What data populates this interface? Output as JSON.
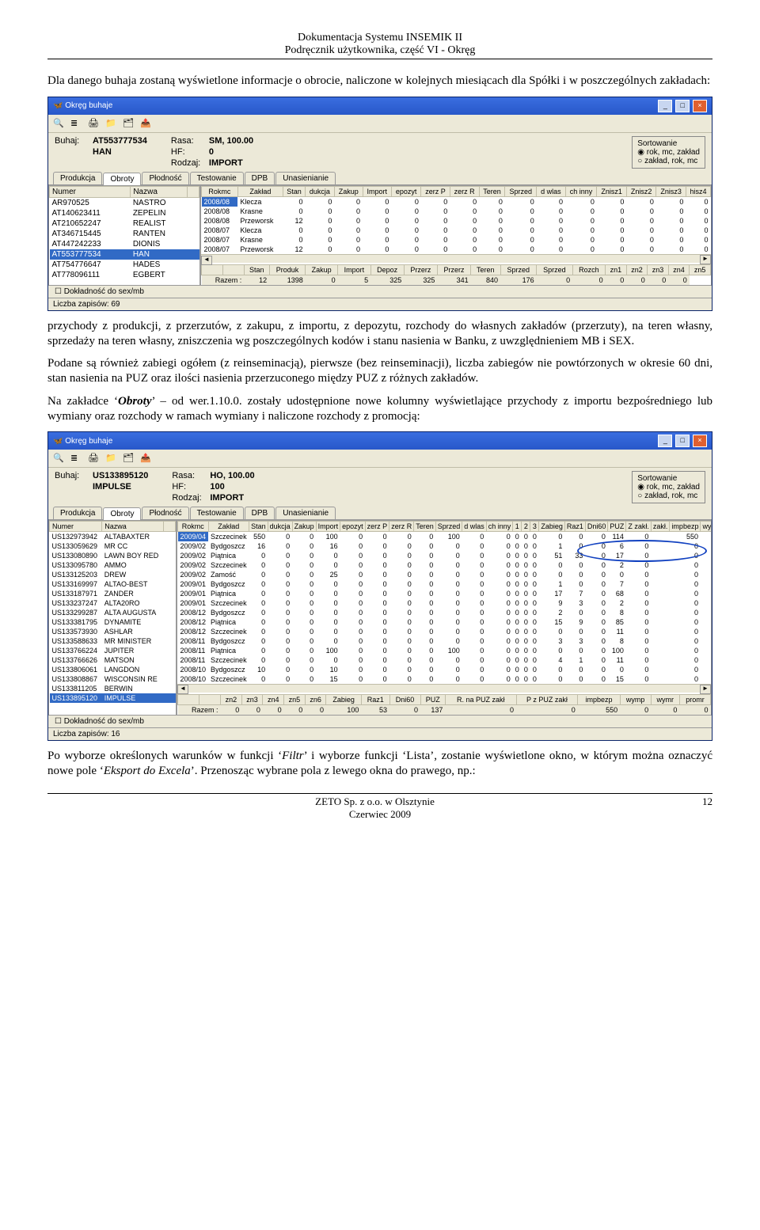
{
  "header": {
    "line1": "Dokumentacja Systemu INSEMIK II",
    "line2": "Podręcznik użytkownika, część VI - Okręg"
  },
  "para1": "Dla danego buhaja zostaną wyświetlone informacje o obrocie, naliczone w kolejnych miesiącach dla Spółki i w poszczególnych zakładach:",
  "win1": {
    "title": "Okręg buhaje",
    "buhaj": "AT553777534",
    "buhaj2": "HAN",
    "rasa": "SM, 100.00",
    "hf": "0",
    "rodzaj": "IMPORT",
    "sort1": "rok, mc, zakład",
    "sort2": "zakład, rok, mc",
    "sortLabel": "Sortowanie",
    "tabs": [
      "Produkcja",
      "Obroty",
      "Płodność",
      "Testowanie",
      "DPB",
      "Unasienianie"
    ],
    "leftHead": [
      "Numer",
      "Nazwa"
    ],
    "leftRows": [
      [
        "AR970525",
        "NASTRO"
      ],
      [
        "AT140623411",
        "ZEPELIN"
      ],
      [
        "AT210652247",
        "REALIST"
      ],
      [
        "AT346715445",
        "RANTEN"
      ],
      [
        "AT447242233",
        "DIONIS"
      ],
      [
        "AT553777534",
        "HAN"
      ],
      [
        "AT754776647",
        "HADES"
      ],
      [
        "AT778096111",
        "EGBERT"
      ]
    ],
    "gridHead": [
      "Rokmc",
      "Zakład",
      "Stan",
      "dukcja",
      "Zakup",
      "Import",
      "epozyt",
      "zerz P",
      "zerz R",
      "Teren",
      "Sprzed",
      "d wlas",
      "ch inny",
      "Znisz1",
      "Znisz2",
      "Znisz3",
      "hisz4"
    ],
    "gridRows": [
      [
        "2008/08",
        "Klecza",
        "0",
        "0",
        "0",
        "0",
        "0",
        "0",
        "0",
        "0",
        "0",
        "0",
        "0",
        "0",
        "0",
        "0",
        "0"
      ],
      [
        "2008/08",
        "Krasne",
        "0",
        "0",
        "0",
        "0",
        "0",
        "0",
        "0",
        "0",
        "0",
        "0",
        "0",
        "0",
        "0",
        "0",
        "0"
      ],
      [
        "2008/08",
        "Przeworsk",
        "12",
        "0",
        "0",
        "0",
        "0",
        "0",
        "0",
        "0",
        "0",
        "0",
        "0",
        "0",
        "0",
        "0",
        "0"
      ],
      [
        "2008/07",
        "Klecza",
        "0",
        "0",
        "0",
        "0",
        "0",
        "0",
        "0",
        "0",
        "0",
        "0",
        "0",
        "0",
        "0",
        "0",
        "0"
      ],
      [
        "2008/07",
        "Krasne",
        "0",
        "0",
        "0",
        "0",
        "0",
        "0",
        "0",
        "0",
        "0",
        "0",
        "0",
        "0",
        "0",
        "0",
        "0"
      ],
      [
        "2008/07",
        "Przeworsk",
        "12",
        "0",
        "0",
        "0",
        "0",
        "0",
        "0",
        "0",
        "0",
        "0",
        "0",
        "0",
        "0",
        "0",
        "0"
      ]
    ],
    "sumHead": [
      "Stan",
      "Produk",
      "Zakup",
      "Import",
      "Depoz",
      "Przerz",
      "Przerz",
      "Teren",
      "Sprzed",
      "Sprzed",
      "Rozch",
      "zn1",
      "zn2",
      "zn3",
      "zn4",
      "zn5"
    ],
    "sumRow": [
      "Razem :",
      "12",
      "1398",
      "0",
      "5",
      "325",
      "325",
      "341",
      "840",
      "176",
      "0",
      "0",
      "0",
      "0",
      "0",
      "0"
    ],
    "chk": "Dokładność do sex/mb",
    "status": "Liczba zapisów: 69"
  },
  "para2": "przychody z produkcji, z przerzutów, z zakupu, z importu, z depozytu, rozchody do własnych zakładów (przerzuty), na teren własny, sprzedaży na teren własny, zniszczenia wg poszczególnych kodów i stanu nasienia w Banku, z uwzględnieniem MB i SEX.",
  "para3": "Podane są również zabiegi ogółem (z reinseminacją), pierwsze (bez reinseminacji), liczba zabiegów nie powtórzonych w okresie 60 dni, stan nasienia na PUZ oraz ilości nasienia przerzuconego między PUZ z różnych zakładów.",
  "para4a": "Na zakładce ‘",
  "para4b": "Obroty",
  "para4c": "’ – od wer.1.10.0. zostały udostępnione nowe kolumny wyświetlające przychody z importu bezpośredniego lub wymiany oraz rozchody w ramach wymiany i naliczone rozchody z promocją:",
  "win2": {
    "title": "Okręg buhaje",
    "buhaj": "US133895120",
    "buhaj2": "IMPULSE",
    "rasa": "HO, 100.00",
    "hf": "100",
    "rodzaj": "IMPORT",
    "sort1": "rok, mc, zakład",
    "sort2": "zakład, rok, mc",
    "sortLabel": "Sortowanie",
    "tabs": [
      "Produkcja",
      "Obroty",
      "Płodność",
      "Testowanie",
      "DPB",
      "Unasienianie"
    ],
    "leftHead": [
      "Numer",
      "Nazwa"
    ],
    "leftRows": [
      [
        "US132973942",
        "ALTABAXTER"
      ],
      [
        "US133059629",
        "MR CC"
      ],
      [
        "US133080890",
        "LAWN BOY RED"
      ],
      [
        "US133095780",
        "AMMO"
      ],
      [
        "US133125203",
        "DREW"
      ],
      [
        "US133169997",
        "ALTAO-BEST"
      ],
      [
        "US133187971",
        "ZANDER"
      ],
      [
        "US133237247",
        "ALTA20RO"
      ],
      [
        "US133299287",
        "ALTA AUGUSTA"
      ],
      [
        "US133381795",
        "DYNAMITE"
      ],
      [
        "US133573930",
        "ASHLAR"
      ],
      [
        "US133588633",
        "MR MINISTER"
      ],
      [
        "US133766224",
        "JUPITER"
      ],
      [
        "US133766626",
        "MATSON"
      ],
      [
        "US133806061",
        "LANGDON"
      ],
      [
        "US133808867",
        "WISCONSIN RE"
      ],
      [
        "US133811205",
        "BERWIN"
      ],
      [
        "US133895120",
        "IMPULSE"
      ]
    ],
    "gridHead": [
      "Rokmc",
      "Zakład",
      "Stan",
      "dukcja",
      "Zakup",
      "Import",
      "epozyt",
      "zerz P",
      "zerz R",
      "Teren",
      "Sprzed",
      "d wlas",
      "ch inny",
      "1",
      "2",
      "3",
      "Zabieg",
      "Raz1",
      "Dni60",
      "PUZ",
      "Z zakł.",
      "zakł.",
      "impbezp",
      "wymp",
      "wymr",
      "promr"
    ],
    "gridRows": [
      [
        "2009/04",
        "Szczecinek",
        "550",
        "0",
        "0",
        "100",
        "0",
        "0",
        "0",
        "0",
        "100",
        "0",
        "0",
        "0",
        "0",
        "0",
        "0",
        "0",
        "0",
        "114",
        "0",
        "",
        "550",
        "0",
        "0",
        "0"
      ],
      [
        "2009/02",
        "Bydgoszcz",
        "16",
        "0",
        "0",
        "16",
        "0",
        "0",
        "0",
        "0",
        "0",
        "0",
        "0",
        "0",
        "0",
        "0",
        "1",
        "0",
        "0",
        "6",
        "0",
        "",
        "0",
        "0",
        "0",
        "0"
      ],
      [
        "2009/02",
        "Piątnica",
        "0",
        "0",
        "0",
        "0",
        "0",
        "0",
        "0",
        "0",
        "0",
        "0",
        "0",
        "0",
        "0",
        "0",
        "51",
        "33",
        "0",
        "17",
        "0",
        "",
        "0",
        "0",
        "0",
        "0"
      ],
      [
        "2009/02",
        "Szczecinek",
        "0",
        "0",
        "0",
        "0",
        "0",
        "0",
        "0",
        "0",
        "0",
        "0",
        "0",
        "0",
        "0",
        "0",
        "0",
        "0",
        "0",
        "2",
        "0",
        "",
        "0",
        "0",
        "0",
        "0"
      ],
      [
        "2009/02",
        "Zamość",
        "0",
        "0",
        "0",
        "25",
        "0",
        "0",
        "0",
        "0",
        "0",
        "0",
        "0",
        "0",
        "0",
        "0",
        "0",
        "0",
        "0",
        "0",
        "0",
        "",
        "0",
        "0",
        "0",
        "0"
      ],
      [
        "2009/01",
        "Bydgoszcz",
        "0",
        "0",
        "0",
        "0",
        "0",
        "0",
        "0",
        "0",
        "0",
        "0",
        "0",
        "0",
        "0",
        "0",
        "1",
        "0",
        "0",
        "7",
        "0",
        "",
        "0",
        "0",
        "0",
        "0"
      ],
      [
        "2009/01",
        "Piątnica",
        "0",
        "0",
        "0",
        "0",
        "0",
        "0",
        "0",
        "0",
        "0",
        "0",
        "0",
        "0",
        "0",
        "0",
        "17",
        "7",
        "0",
        "68",
        "0",
        "",
        "0",
        "0",
        "0",
        "0"
      ],
      [
        "2009/01",
        "Szczecinek",
        "0",
        "0",
        "0",
        "0",
        "0",
        "0",
        "0",
        "0",
        "0",
        "0",
        "0",
        "0",
        "0",
        "0",
        "9",
        "3",
        "0",
        "2",
        "0",
        "",
        "0",
        "0",
        "0",
        "0"
      ],
      [
        "2008/12",
        "Bydgoszcz",
        "0",
        "0",
        "0",
        "0",
        "0",
        "0",
        "0",
        "0",
        "0",
        "0",
        "0",
        "0",
        "0",
        "0",
        "2",
        "0",
        "0",
        "8",
        "0",
        "",
        "0",
        "0",
        "0",
        "0"
      ],
      [
        "2008/12",
        "Piątnica",
        "0",
        "0",
        "0",
        "0",
        "0",
        "0",
        "0",
        "0",
        "0",
        "0",
        "0",
        "0",
        "0",
        "0",
        "15",
        "9",
        "0",
        "85",
        "0",
        "",
        "0",
        "0",
        "0",
        "0"
      ],
      [
        "2008/12",
        "Szczecinek",
        "0",
        "0",
        "0",
        "0",
        "0",
        "0",
        "0",
        "0",
        "0",
        "0",
        "0",
        "0",
        "0",
        "0",
        "0",
        "0",
        "0",
        "11",
        "0",
        "",
        "0",
        "0",
        "0",
        "0"
      ],
      [
        "2008/11",
        "Bydgoszcz",
        "0",
        "0",
        "0",
        "0",
        "0",
        "0",
        "0",
        "0",
        "0",
        "0",
        "0",
        "0",
        "0",
        "0",
        "3",
        "3",
        "0",
        "8",
        "0",
        "",
        "0",
        "0",
        "0",
        "0"
      ],
      [
        "2008/11",
        "Piątnica",
        "0",
        "0",
        "0",
        "100",
        "0",
        "0",
        "0",
        "0",
        "100",
        "0",
        "0",
        "0",
        "0",
        "0",
        "0",
        "0",
        "0",
        "100",
        "0",
        "",
        "0",
        "0",
        "0",
        "0"
      ],
      [
        "2008/11",
        "Szczecinek",
        "0",
        "0",
        "0",
        "0",
        "0",
        "0",
        "0",
        "0",
        "0",
        "0",
        "0",
        "0",
        "0",
        "0",
        "4",
        "1",
        "0",
        "11",
        "0",
        "",
        "0",
        "0",
        "0",
        "0"
      ],
      [
        "2008/10",
        "Bydgoszcz",
        "10",
        "0",
        "0",
        "10",
        "0",
        "0",
        "0",
        "0",
        "0",
        "0",
        "0",
        "0",
        "0",
        "0",
        "0",
        "0",
        "0",
        "0",
        "0",
        "",
        "0",
        "0",
        "0",
        "0"
      ],
      [
        "2008/10",
        "Szczecinek",
        "0",
        "0",
        "0",
        "15",
        "0",
        "0",
        "0",
        "0",
        "0",
        "0",
        "0",
        "0",
        "0",
        "0",
        "0",
        "0",
        "0",
        "15",
        "0",
        "",
        "0",
        "0",
        "0",
        "0"
      ]
    ],
    "sumHead": [
      "zn2",
      "zn3",
      "zn4",
      "zn5",
      "zn6",
      "Zabieg",
      "Raz1",
      "Dni60",
      "PUZ",
      "R. na PUZ zakł",
      "P z PUZ zakł",
      "impbezp",
      "wymp",
      "wymr",
      "promr"
    ],
    "sumRow": [
      "Razem :",
      "0",
      "0",
      "0",
      "0",
      "0",
      "100",
      "53",
      "0",
      "137",
      "0",
      "0",
      "550",
      "0",
      "0",
      "0"
    ],
    "chk": "Dokładność do sex/mb",
    "status": "Liczba zapisów: 16"
  },
  "para5a": "Po wyborze określonych warunków w funkcji ‘",
  "para5b": "Filtr",
  "para5c": "’ i wyborze funkcji ‘Lista’, zostanie wyświetlone okno, w którym można oznaczyć nowe pole ‘",
  "para5d": "Eksport do Excela",
  "para5e": "’. Przenosząc wybrane pola z lewego okna do prawego, np.:",
  "footer": {
    "line1": "ZETO Sp. z o.o. w Olsztynie",
    "line2": "Czerwiec 2009",
    "page": "12"
  },
  "labels": {
    "buhaj": "Buhaj:",
    "rasa": "Rasa:",
    "hf": "HF:",
    "rodzaj": "Rodzaj:"
  }
}
